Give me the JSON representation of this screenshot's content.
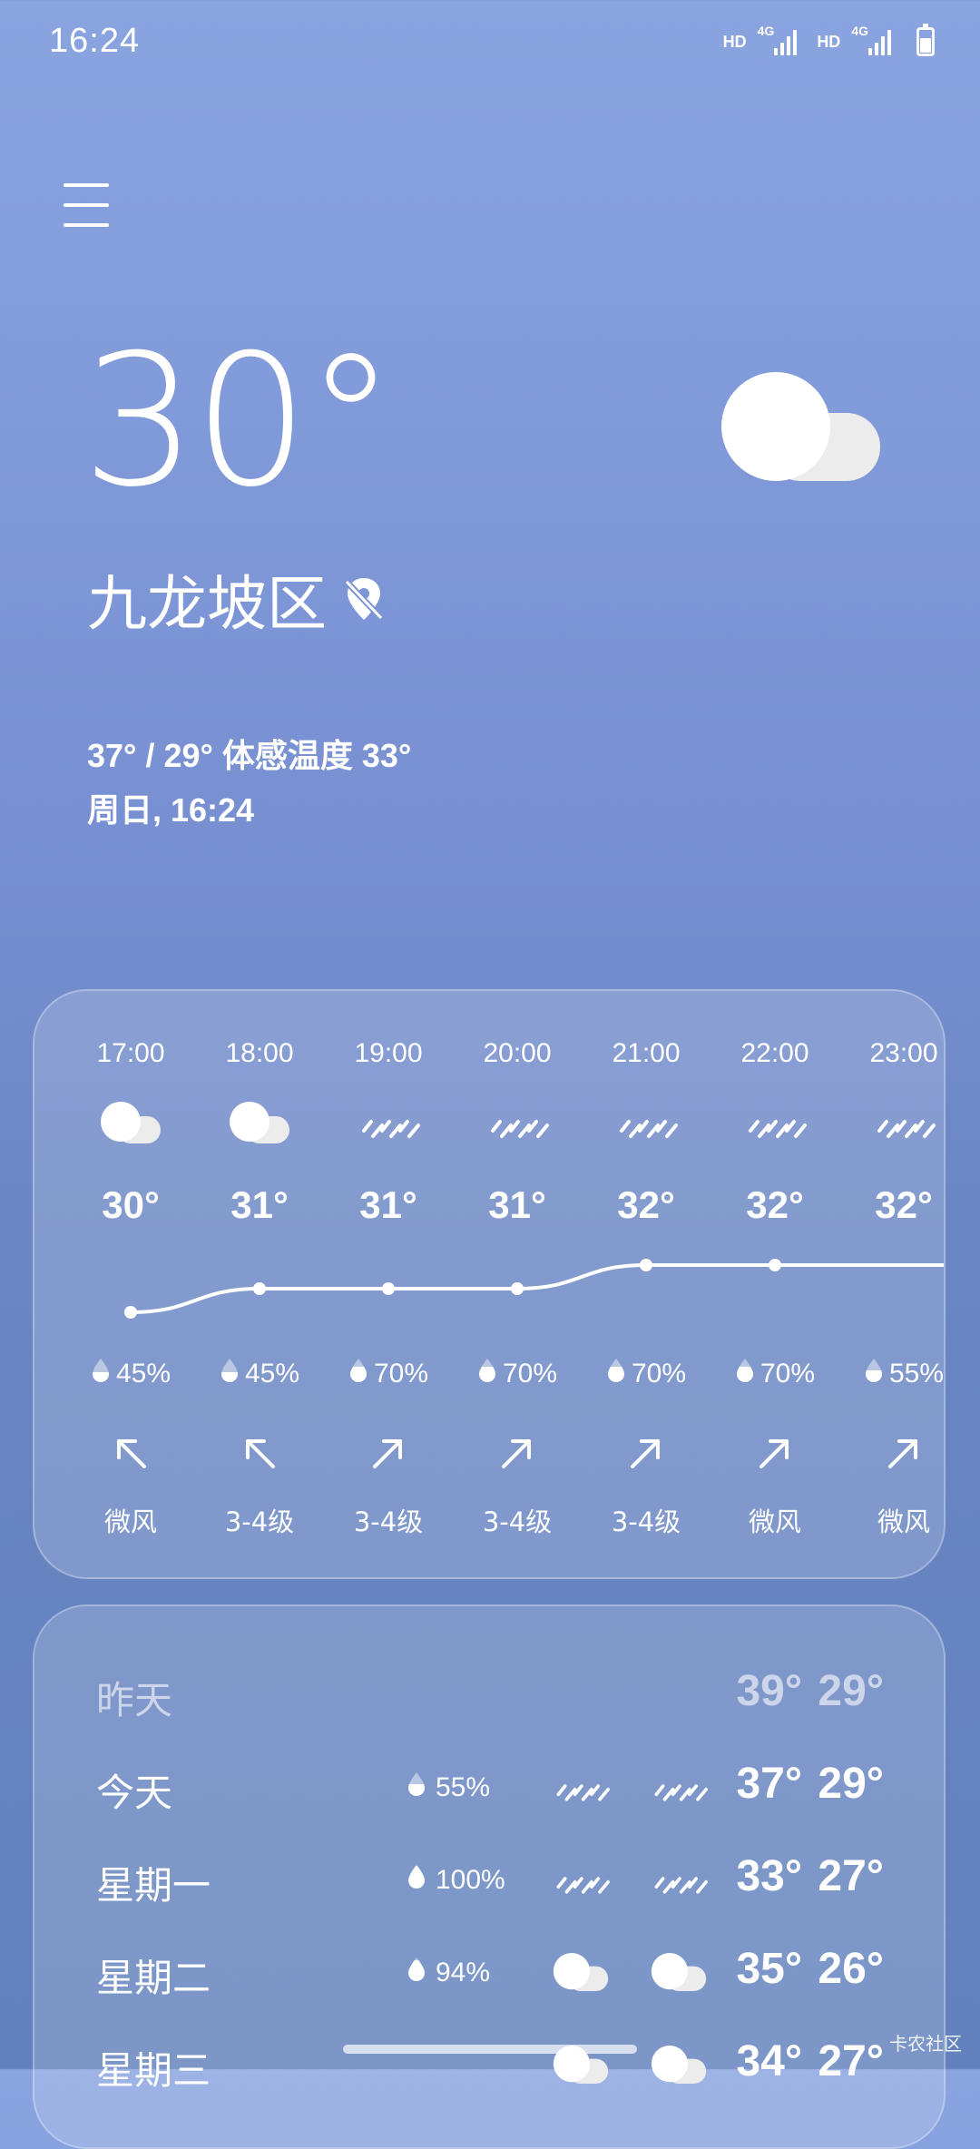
{
  "status_bar": {
    "time": "16:24",
    "sim1_label": "HD",
    "sim1_network": "4G",
    "sim2_label": "HD",
    "sim2_network": "4G"
  },
  "current": {
    "temperature": "30°",
    "location": "九龙坡区",
    "summary_range": "37° / 29° 体感温度 33°",
    "date_time": "周日, 16:24",
    "condition_icon": "partly-cloudy-icon"
  },
  "hourly": [
    {
      "time": "17:00",
      "icon": "cloudy",
      "temp": "30°",
      "temp_value": 30,
      "precip": "45%",
      "precip_level": 0.45,
      "wind_dir": "nw",
      "wind": "微风"
    },
    {
      "time": "18:00",
      "icon": "cloudy",
      "temp": "31°",
      "temp_value": 31,
      "precip": "45%",
      "precip_level": 0.45,
      "wind_dir": "nw",
      "wind": "3-4级"
    },
    {
      "time": "19:00",
      "icon": "rain",
      "temp": "31°",
      "temp_value": 31,
      "precip": "70%",
      "precip_level": 0.7,
      "wind_dir": "ne",
      "wind": "3-4级"
    },
    {
      "time": "20:00",
      "icon": "rain",
      "temp": "31°",
      "temp_value": 31,
      "precip": "70%",
      "precip_level": 0.7,
      "wind_dir": "ne",
      "wind": "3-4级"
    },
    {
      "time": "21:00",
      "icon": "rain",
      "temp": "32°",
      "temp_value": 32,
      "precip": "70%",
      "precip_level": 0.7,
      "wind_dir": "ne",
      "wind": "3-4级"
    },
    {
      "time": "22:00",
      "icon": "rain",
      "temp": "32°",
      "temp_value": 32,
      "precip": "70%",
      "precip_level": 0.7,
      "wind_dir": "ne",
      "wind": "微风"
    },
    {
      "time": "23:00",
      "icon": "rain",
      "temp": "32°",
      "temp_value": 32,
      "precip": "55%",
      "precip_level": 0.55,
      "wind_dir": "ne",
      "wind": "微风"
    }
  ],
  "daily": [
    {
      "day": "昨天",
      "precip": "",
      "precip_level": 0,
      "day_icon": "",
      "night_icon": "",
      "temps": "39° 29°",
      "past": true
    },
    {
      "day": "今天",
      "precip": "55%",
      "precip_level": 0.55,
      "day_icon": "rain",
      "night_icon": "rain",
      "temps": "37° 29°",
      "past": false
    },
    {
      "day": "星期一",
      "precip": "100%",
      "precip_level": 1.0,
      "day_icon": "rain",
      "night_icon": "rain",
      "temps": "33° 27°",
      "past": false
    },
    {
      "day": "星期二",
      "precip": "94%",
      "precip_level": 0.94,
      "day_icon": "cloudy",
      "night_icon": "cloudy",
      "temps": "35° 26°",
      "past": false
    },
    {
      "day": "星期三",
      "precip": "",
      "precip_level": 0,
      "day_icon": "cloudy",
      "night_icon": "cloudy",
      "temps": "34° 27°",
      "past": false
    }
  ],
  "watermark": "卡农社区",
  "colors": {
    "bg_top": "#8aa4e0",
    "bg_bottom": "#6281bd",
    "card_fill": "rgba(255,255,255,0.17)",
    "text": "#ffffff"
  }
}
